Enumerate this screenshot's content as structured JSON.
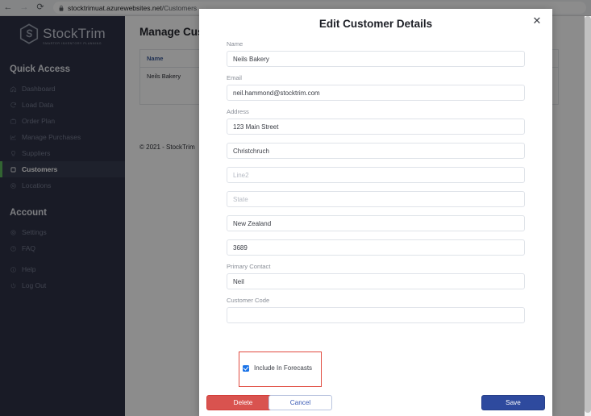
{
  "browser": {
    "back_icon": "back-arrow-icon",
    "forward_icon": "forward-arrow-icon",
    "reload_icon": "reload-icon",
    "lock_icon": "lock-icon",
    "url_host": "stocktrimuat.azurewebsites.net",
    "url_path": "/Customers"
  },
  "sidebar": {
    "logo": {
      "word": "StockTrim",
      "tagline": "SMARTER INVENTORY PLANNING"
    },
    "sections": [
      {
        "title": "Quick Access",
        "items": [
          {
            "label": "Dashboard",
            "icon": "home-icon",
            "active": false
          },
          {
            "label": "Load Data",
            "icon": "refresh-icon",
            "active": false
          },
          {
            "label": "Order Plan",
            "icon": "briefcase-icon",
            "active": false
          },
          {
            "label": "Manage Purchases",
            "icon": "chart-icon",
            "active": false
          },
          {
            "label": "Suppliers",
            "icon": "lightbulb-icon",
            "active": false
          },
          {
            "label": "Customers",
            "icon": "square-icon",
            "active": true
          },
          {
            "label": "Locations",
            "icon": "target-icon",
            "active": false
          }
        ]
      },
      {
        "title": "Account",
        "items": [
          {
            "label": "Settings",
            "icon": "gear-icon",
            "active": false
          },
          {
            "label": "FAQ",
            "icon": "question-icon",
            "active": false
          },
          {
            "label": "Help",
            "icon": "info-icon",
            "active": false
          },
          {
            "label": "Log Out",
            "icon": "power-icon",
            "active": false
          }
        ]
      }
    ],
    "accent_active": "#5bb75b",
    "background": "#2e3245"
  },
  "main": {
    "page_title": "Manage Customers",
    "table": {
      "columns": [
        "Name"
      ],
      "rows": [
        [
          "Neils Bakery"
        ]
      ]
    },
    "footer": "© 2021 - StockTrim"
  },
  "modal": {
    "title": "Edit Customer Details",
    "close_icon": "close-icon",
    "fields": [
      {
        "label": "Name",
        "value": "Neils Bakery",
        "placeholder": "",
        "name": "name"
      },
      {
        "label": "Email",
        "value": "neil.hammond@stocktrim.com",
        "placeholder": "",
        "name": "email"
      },
      {
        "label": "Address",
        "value": "123 Main Street",
        "placeholder": "",
        "name": "address-line1"
      },
      {
        "label": "",
        "value": "Christchruch",
        "placeholder": "",
        "name": "address-city"
      },
      {
        "label": "",
        "value": "",
        "placeholder": "Line2",
        "name": "address-line2"
      },
      {
        "label": "",
        "value": "",
        "placeholder": "State",
        "name": "address-state"
      },
      {
        "label": "",
        "value": "New Zealand",
        "placeholder": "",
        "name": "address-country"
      },
      {
        "label": "",
        "value": "3689",
        "placeholder": "",
        "name": "address-postcode"
      },
      {
        "label": "Primary Contact",
        "value": "Neil",
        "placeholder": "",
        "name": "primary-contact"
      },
      {
        "label": "Customer Code",
        "value": "",
        "placeholder": "",
        "name": "customer-code"
      }
    ],
    "checkbox": {
      "label": "Include In Forecasts",
      "checked": true,
      "highlight_color": "#e04a3f"
    },
    "buttons": {
      "delete": "Delete",
      "cancel": "Cancel",
      "save": "Save"
    },
    "colors": {
      "delete": "#d9534f",
      "save": "#2e4a9e",
      "cancel_text": "#3b5bb5"
    }
  }
}
